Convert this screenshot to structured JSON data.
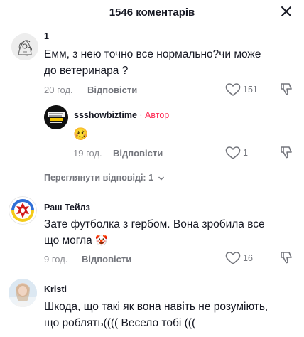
{
  "header": {
    "title": "1546 коментарів"
  },
  "comments": [
    {
      "author": "1",
      "text_line1": "Емм, з нею точно все нормально?чи може",
      "text_line2": "до ветеринара ?",
      "time": "20 год.",
      "reply_label": "Відповісти",
      "likes": "151"
    },
    {
      "author": "ssshowbiztime",
      "separator": " · ",
      "author_tag": "Автор",
      "text": "🥴",
      "time": "19 год.",
      "reply_label": "Відповісти",
      "likes": "1"
    },
    {
      "author": "Раш Тейлз",
      "text_line1": "Зате футболка з гербом. Вона зробила все",
      "text_line2": "що могла",
      "text_emoji": "🤡",
      "time": "9 год.",
      "reply_label": "Відповісти",
      "likes": "16"
    },
    {
      "author": "Kristi",
      "text_line1": "Шкода, що такі як вона навіть не розуміють,",
      "text_line2": "що роблять(((( Весело тобі (((",
      "time": "",
      "reply_label": "",
      "likes": ""
    }
  ],
  "view_replies": "Переглянути відповіді: 1",
  "colors": {
    "text": "#161823",
    "muted": "#8a8b91",
    "author_tag": "#fe2c55"
  },
  "icons": [
    "close-icon",
    "heart-icon",
    "dislike-icon",
    "chevron-down-icon"
  ]
}
